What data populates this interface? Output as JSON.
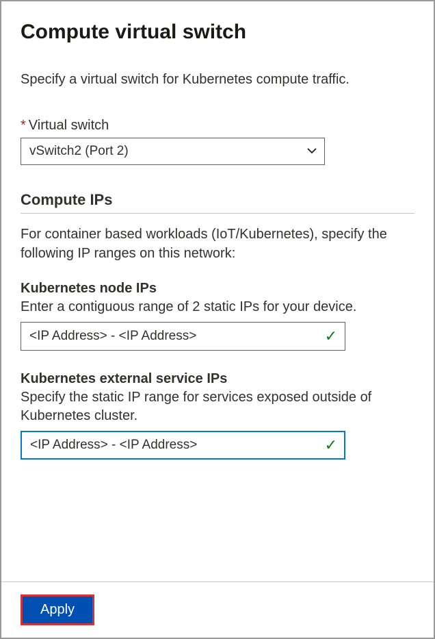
{
  "title": "Compute virtual switch",
  "description": "Specify a virtual switch for Kubernetes compute traffic.",
  "virtualSwitch": {
    "label": "Virtual switch",
    "value": "vSwitch2 (Port 2)"
  },
  "computeIps": {
    "header": "Compute IPs",
    "description": "For container based workloads (IoT/Kubernetes), specify the following IP ranges on this network:"
  },
  "nodeIps": {
    "label": "Kubernetes node IPs",
    "description": "Enter a contiguous range of 2 static IPs for your device.",
    "value": "<IP Address> - <IP Address>"
  },
  "serviceIps": {
    "label": "Kubernetes external service IPs",
    "description": "Specify the static IP range for services exposed outside of Kubernetes cluster.",
    "value": "<IP Address> - <IP Address>"
  },
  "footer": {
    "apply": "Apply"
  }
}
